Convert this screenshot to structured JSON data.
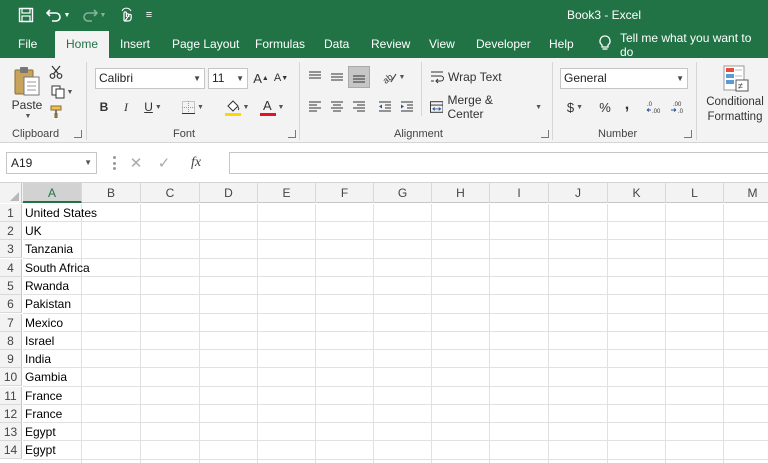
{
  "titlebar": {
    "title": "Book3  -  Excel",
    "customize_glyph": "≡"
  },
  "tabs": [
    "File",
    "Home",
    "Insert",
    "Page Layout",
    "Formulas",
    "Data",
    "Review",
    "View",
    "Developer",
    "Help"
  ],
  "tell_me": "Tell me what you want to do",
  "ribbon": {
    "clipboard": {
      "label": "Clipboard",
      "paste": "Paste"
    },
    "font": {
      "label": "Font",
      "name": "Calibri",
      "size": "11"
    },
    "alignment": {
      "label": "Alignment",
      "wrap_text": "Wrap Text",
      "merge_center": "Merge & Center"
    },
    "number": {
      "label": "Number",
      "format": "General",
      "currency": "$",
      "percent": "%",
      "comma": ","
    },
    "styles": {
      "conditional_formatting": "Conditional Formatting"
    }
  },
  "formula_bar": {
    "name_box": "A19",
    "fx": "fx",
    "value": ""
  },
  "grid": {
    "columns": [
      "A",
      "B",
      "C",
      "D",
      "E",
      "F",
      "G",
      "H",
      "I",
      "J",
      "K",
      "L",
      "M"
    ],
    "rows": [
      {
        "num": "1",
        "a": "United States"
      },
      {
        "num": "2",
        "a": "UK"
      },
      {
        "num": "3",
        "a": "Tanzania"
      },
      {
        "num": "4",
        "a": "South Africa"
      },
      {
        "num": "5",
        "a": "Rwanda"
      },
      {
        "num": "6",
        "a": "Pakistan"
      },
      {
        "num": "7",
        "a": "Mexico"
      },
      {
        "num": "8",
        "a": "Israel"
      },
      {
        "num": "9",
        "a": "India"
      },
      {
        "num": "10",
        "a": "Gambia"
      },
      {
        "num": "11",
        "a": "France"
      },
      {
        "num": "12",
        "a": "France"
      },
      {
        "num": "13",
        "a": "Egypt"
      },
      {
        "num": "14",
        "a": "Egypt"
      }
    ]
  },
  "colors": {
    "accent": "#217346",
    "font_color_bar": "#e81123",
    "fill_color_bar": "#ffd700"
  }
}
